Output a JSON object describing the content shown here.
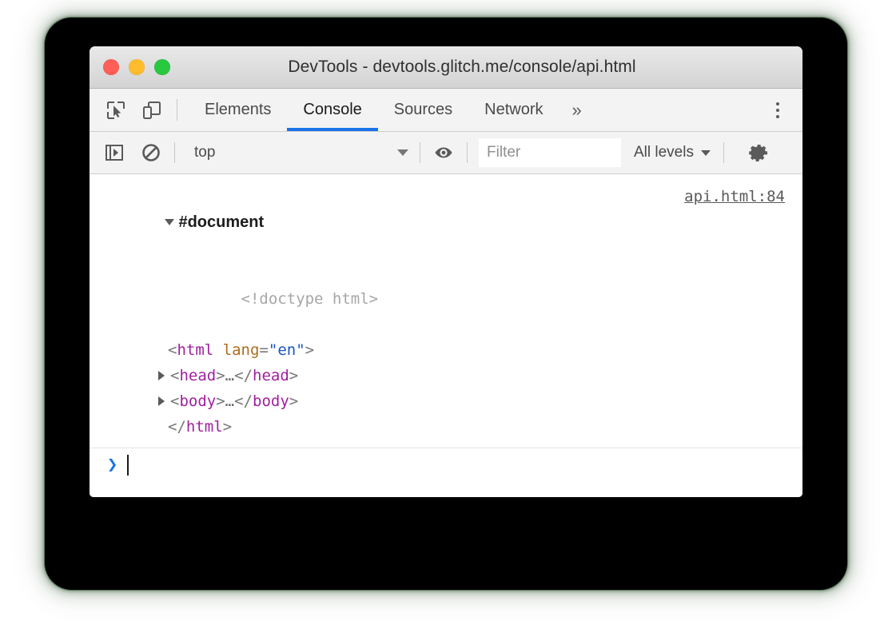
{
  "window": {
    "title": "DevTools - devtools.glitch.me/console/api.html",
    "traffic_lights": [
      {
        "name": "close",
        "color": "#ff5f57"
      },
      {
        "name": "minimize",
        "color": "#ffbd2e"
      },
      {
        "name": "maximize",
        "color": "#28c840"
      }
    ]
  },
  "toolbar": {
    "inspect_icon": "inspect-element-icon",
    "device_icon": "device-toolbar-icon",
    "overflow_label": "»",
    "menu_icon": "more-vertical-icon",
    "tabs": [
      {
        "label": "Elements",
        "active": false
      },
      {
        "label": "Console",
        "active": true
      },
      {
        "label": "Sources",
        "active": false
      },
      {
        "label": "Network",
        "active": false
      }
    ],
    "active_tab_color": "#1a73e8"
  },
  "console_toolbar": {
    "sidebar_icon": "show-console-sidebar-icon",
    "clear_icon": "clear-console-icon",
    "context": {
      "value": "top"
    },
    "eye_icon": "create-live-expression-icon",
    "filter": {
      "value": "",
      "placeholder": "Filter"
    },
    "levels": {
      "value": "All levels"
    },
    "settings_icon": "settings-gear-icon"
  },
  "console": {
    "source_link": "api.html:84",
    "rows": {
      "document": "#document",
      "doctype": "<!doctype html>",
      "html_open_lt": "<",
      "html_open_tag": "html",
      "html_attr_name": " lang",
      "html_attr_eq": "=",
      "html_attr_val": "\"en\"",
      "html_open_gt": ">",
      "head_lt": "<",
      "head_tag": "head",
      "head_gt": ">",
      "head_ellipsis": "…",
      "head_close_lt": "</",
      "head_close_tag": "head",
      "head_close_gt": ">",
      "body_lt": "<",
      "body_tag": "body",
      "body_gt": ">",
      "body_ellipsis": "…",
      "body_close_lt": "</",
      "body_close_tag": "body",
      "body_close_gt": ">",
      "html_close_lt": "</",
      "html_close_tag": "html",
      "html_close_gt": ">"
    },
    "prompt": {
      "chevron": "❯",
      "value": ""
    }
  }
}
